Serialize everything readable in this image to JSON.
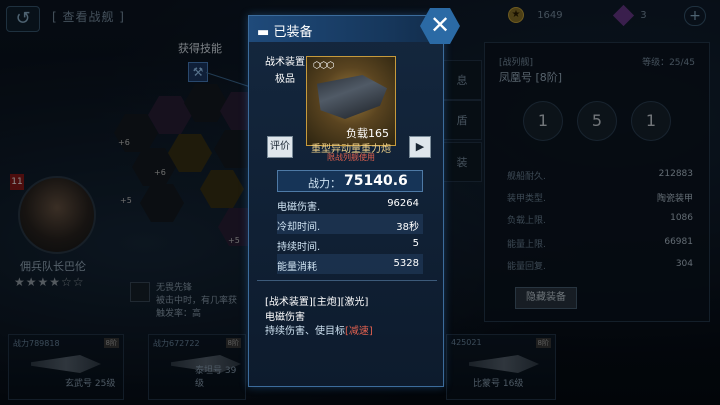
{
  "header": {
    "title": "[ 查看战舰 ]",
    "gold": "1649",
    "gems": "3",
    "add": "+"
  },
  "popup": {
    "title": "已装备",
    "item": {
      "kind": "战术装置",
      "tier": "极品",
      "load_label": "负载165",
      "name": "重型异动量重力炮",
      "restriction": "限战列舰使用"
    },
    "rate_label": "评价",
    "play_label": "▶",
    "power_label": "战力：",
    "power_value": "75140.6",
    "stats": [
      {
        "key": "电磁伤害.",
        "value": "96264"
      },
      {
        "key": "冷却时间.",
        "value": "38秒"
      },
      {
        "key": "持续时间.",
        "value": "5"
      },
      {
        "key": "能量消耗",
        "value": "5328"
      }
    ],
    "tags": "[战术装置][主炮][激光]",
    "effect_name": "电磁伤害",
    "effect_desc_prefix": "持续伤害、使目标",
    "effect_desc_highlight": "[减速]",
    "close_label": "✕"
  },
  "character": {
    "name": "佣兵队长巴伦",
    "stars": "★★★★☆☆",
    "skill_label": "获得技能",
    "badge": "11",
    "trait_name": "无畏先锋",
    "trait_desc": "被击中时，有几率获",
    "trait_trigger": "触发率：高",
    "hex_costs": [
      "+6",
      "+6",
      "+5",
      "+5"
    ]
  },
  "right_panel": {
    "type": "[战列舰]",
    "level": "等级：25/45",
    "ship": "凤凰号 [8阶]",
    "icon_badges": [
      "1",
      "5",
      "1"
    ],
    "rows": [
      {
        "k": "舰船耐久.",
        "v": "212883"
      },
      {
        "k": "装甲类型.",
        "v": "陶瓷装甲"
      },
      {
        "k": "负载上限.",
        "v": "1086"
      },
      {
        "k": "能量上限.",
        "v": "66981"
      },
      {
        "k": "能量回复.",
        "v": "304"
      }
    ],
    "hide_button": "隐藏装备",
    "side_tabs": [
      "息",
      "盾",
      "装"
    ]
  },
  "ships": [
    {
      "power": "战力789818",
      "tag": "8阶",
      "name": "玄武号 25级"
    },
    {
      "power": "战力672722",
      "tag": "8阶",
      "name": "泰坦号 39级"
    },
    {
      "power": "425021",
      "tag": "8阶",
      "name": "比蒙号 16级"
    }
  ]
}
